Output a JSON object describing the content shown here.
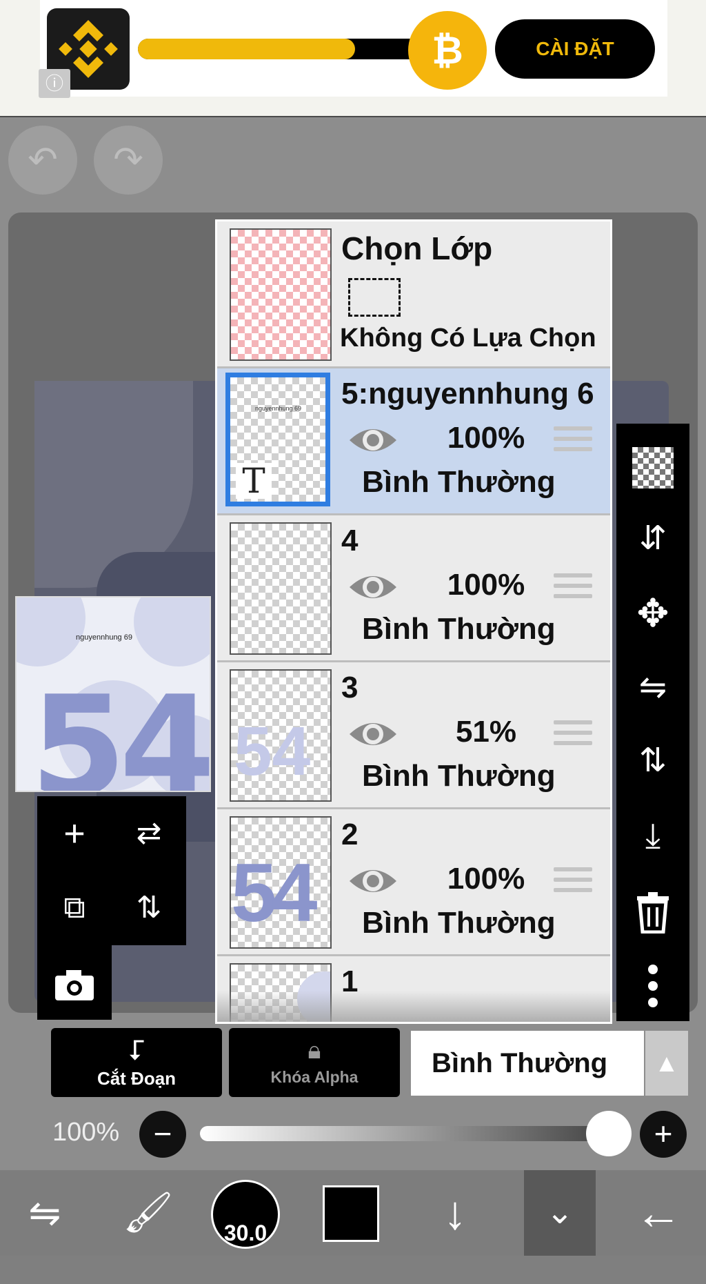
{
  "ad": {
    "install_label": "CÀI ĐẶT",
    "progress_fraction": 0.75,
    "brand_color": "#f0b90b",
    "info_icon": "info-icon",
    "coin_icon": "bitcoin-icon"
  },
  "history": {
    "undo_icon": "undo-icon",
    "redo_icon": "redo-icon"
  },
  "preview": {
    "watermark_text": "nguyennhung 69",
    "number": "54"
  },
  "layers_panel": {
    "selection_layer": {
      "title": "Chọn Lớp",
      "subtitle": "Không Có Lựa Chọn"
    },
    "layers": [
      {
        "name": "5:nguyennhung 6",
        "opacity": "100%",
        "mode": "Bình Thường",
        "selected": true,
        "type": "text"
      },
      {
        "name": "4",
        "opacity": "100%",
        "mode": "Bình Thường",
        "selected": false
      },
      {
        "name": "3",
        "opacity": "51%",
        "mode": "Bình Thường",
        "selected": false
      },
      {
        "name": "2",
        "opacity": "100%",
        "mode": "Bình Thường",
        "selected": false
      },
      {
        "name": "1",
        "opacity": "",
        "mode": "",
        "selected": false
      }
    ]
  },
  "right_tools": [
    "transparent-bg-icon",
    "swap-layers-icon",
    "move-icon",
    "flip-horizontal-icon",
    "flip-vertical-icon",
    "merge-down-icon",
    "delete-icon",
    "more-options-icon"
  ],
  "left_tools": [
    "add-layer-icon",
    "flip-layer-horizontal-icon",
    "add-copy-layer-icon",
    "flip-layer-vertical-icon",
    "camera-icon"
  ],
  "layer_options": {
    "clipping_label": "Cắt Đoạn",
    "alpha_lock_label": "Khóa Alpha",
    "blend_mode": "Bình Thường"
  },
  "opacity_slider": {
    "value_label": "100%",
    "value": 100
  },
  "toolbar": {
    "brush_size": "30.0",
    "current_color": "#000000"
  }
}
